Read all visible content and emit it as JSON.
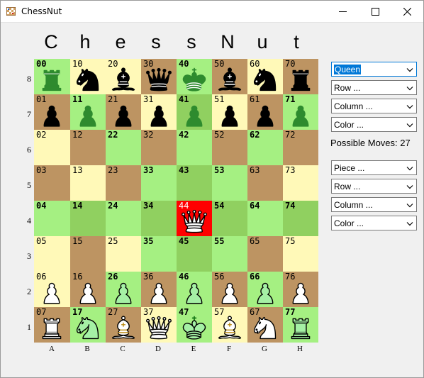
{
  "window": {
    "title": "ChessNut",
    "minimize_icon": "minimize-icon",
    "maximize_icon": "maximize-icon",
    "close_icon": "close-icon"
  },
  "header_letters": [
    "C",
    "h",
    "e",
    "s",
    "s",
    "N",
    "u",
    "t"
  ],
  "colors": {
    "light_square": "#fff9b8",
    "dark_square": "#bd9462",
    "move_light": "#a5f082",
    "move_dark": "#90d060",
    "selected": "#ff0000",
    "white_piece": "#ffffff",
    "black_piece": "#000000",
    "highlight_white_piece": "#a5f0a5",
    "highlight_black_piece": "#2e8b2e"
  },
  "board": {
    "rank_labels": [
      "8",
      "7",
      "6",
      "5",
      "4",
      "3",
      "2",
      "1"
    ],
    "file_labels": [
      "A",
      "B",
      "C",
      "D",
      "E",
      "F",
      "G",
      "H"
    ],
    "rows": [
      [
        {
          "id": "00",
          "bg": "move_light",
          "piece": "rook",
          "color": "green_dark",
          "bold": true
        },
        {
          "id": "10",
          "bg": "light",
          "piece": "knight",
          "color": "black",
          "bold": false
        },
        {
          "id": "20",
          "bg": "light",
          "piece": "bishop",
          "color": "black",
          "bold": false
        },
        {
          "id": "30",
          "bg": "dark",
          "piece": "queen",
          "color": "black",
          "bold": false
        },
        {
          "id": "40",
          "bg": "move_light",
          "piece": "king",
          "color": "green_dark",
          "bold": true
        },
        {
          "id": "50",
          "bg": "dark",
          "piece": "bishop",
          "color": "black",
          "bold": false
        },
        {
          "id": "60",
          "bg": "light",
          "piece": "knight",
          "color": "black",
          "bold": false
        },
        {
          "id": "70",
          "bg": "dark",
          "piece": "rook",
          "color": "black",
          "bold": false
        }
      ],
      [
        {
          "id": "01",
          "bg": "dark",
          "piece": "pawn",
          "color": "black",
          "bold": false
        },
        {
          "id": "11",
          "bg": "move_light",
          "piece": "pawn",
          "color": "green_dark",
          "bold": true
        },
        {
          "id": "21",
          "bg": "dark",
          "piece": "pawn",
          "color": "black",
          "bold": false
        },
        {
          "id": "31",
          "bg": "light",
          "piece": "pawn",
          "color": "black",
          "bold": false
        },
        {
          "id": "41",
          "bg": "move_dark",
          "piece": "pawn",
          "color": "green_dark",
          "bold": true
        },
        {
          "id": "51",
          "bg": "light",
          "piece": "pawn",
          "color": "black",
          "bold": false
        },
        {
          "id": "61",
          "bg": "dark",
          "piece": "pawn",
          "color": "black",
          "bold": false
        },
        {
          "id": "71",
          "bg": "move_light",
          "piece": "pawn",
          "color": "green_dark",
          "bold": true
        }
      ],
      [
        {
          "id": "02",
          "bg": "light",
          "piece": "",
          "color": "",
          "bold": false
        },
        {
          "id": "12",
          "bg": "dark",
          "piece": "",
          "color": "",
          "bold": false
        },
        {
          "id": "22",
          "bg": "move_light",
          "piece": "",
          "color": "",
          "bold": true
        },
        {
          "id": "32",
          "bg": "dark",
          "piece": "",
          "color": "",
          "bold": false
        },
        {
          "id": "42",
          "bg": "move_light",
          "piece": "",
          "color": "",
          "bold": true
        },
        {
          "id": "52",
          "bg": "dark",
          "piece": "",
          "color": "",
          "bold": false
        },
        {
          "id": "62",
          "bg": "move_light",
          "piece": "",
          "color": "",
          "bold": true
        },
        {
          "id": "72",
          "bg": "dark",
          "piece": "",
          "color": "",
          "bold": false
        }
      ],
      [
        {
          "id": "03",
          "bg": "dark",
          "piece": "",
          "color": "",
          "bold": false
        },
        {
          "id": "13",
          "bg": "light",
          "piece": "",
          "color": "",
          "bold": false
        },
        {
          "id": "23",
          "bg": "dark",
          "piece": "",
          "color": "",
          "bold": false
        },
        {
          "id": "33",
          "bg": "move_light",
          "piece": "",
          "color": "",
          "bold": true
        },
        {
          "id": "43",
          "bg": "move_dark",
          "piece": "",
          "color": "",
          "bold": true
        },
        {
          "id": "53",
          "bg": "move_light",
          "piece": "",
          "color": "",
          "bold": true
        },
        {
          "id": "63",
          "bg": "dark",
          "piece": "",
          "color": "",
          "bold": false
        },
        {
          "id": "73",
          "bg": "light",
          "piece": "",
          "color": "",
          "bold": false
        }
      ],
      [
        {
          "id": "04",
          "bg": "move_light",
          "piece": "",
          "color": "",
          "bold": true
        },
        {
          "id": "14",
          "bg": "move_dark",
          "piece": "",
          "color": "",
          "bold": true
        },
        {
          "id": "24",
          "bg": "move_light",
          "piece": "",
          "color": "",
          "bold": true
        },
        {
          "id": "34",
          "bg": "move_dark",
          "piece": "",
          "color": "",
          "bold": true
        },
        {
          "id": "44",
          "bg": "selected",
          "piece": "queen",
          "color": "white",
          "bold": false
        },
        {
          "id": "54",
          "bg": "move_dark",
          "piece": "",
          "color": "",
          "bold": true
        },
        {
          "id": "64",
          "bg": "move_light",
          "piece": "",
          "color": "",
          "bold": true
        },
        {
          "id": "74",
          "bg": "move_dark",
          "piece": "",
          "color": "",
          "bold": true
        }
      ],
      [
        {
          "id": "05",
          "bg": "light",
          "piece": "",
          "color": "",
          "bold": false
        },
        {
          "id": "15",
          "bg": "dark",
          "piece": "",
          "color": "",
          "bold": false
        },
        {
          "id": "25",
          "bg": "light",
          "piece": "",
          "color": "",
          "bold": false
        },
        {
          "id": "35",
          "bg": "move_light",
          "piece": "",
          "color": "",
          "bold": true
        },
        {
          "id": "45",
          "bg": "move_dark",
          "piece": "",
          "color": "",
          "bold": true
        },
        {
          "id": "55",
          "bg": "move_light",
          "piece": "",
          "color": "",
          "bold": true
        },
        {
          "id": "65",
          "bg": "dark",
          "piece": "",
          "color": "",
          "bold": false
        },
        {
          "id": "75",
          "bg": "light",
          "piece": "",
          "color": "",
          "bold": false
        }
      ],
      [
        {
          "id": "06",
          "bg": "light",
          "piece": "pawn",
          "color": "white",
          "bold": false
        },
        {
          "id": "16",
          "bg": "dark",
          "piece": "pawn",
          "color": "white",
          "bold": false
        },
        {
          "id": "26",
          "bg": "move_light",
          "piece": "pawn",
          "color": "green_light",
          "bold": true
        },
        {
          "id": "36",
          "bg": "dark",
          "piece": "pawn",
          "color": "white",
          "bold": false
        },
        {
          "id": "46",
          "bg": "move_light",
          "piece": "pawn",
          "color": "green_light",
          "bold": true
        },
        {
          "id": "56",
          "bg": "dark",
          "piece": "pawn",
          "color": "white",
          "bold": false
        },
        {
          "id": "66",
          "bg": "move_light",
          "piece": "pawn",
          "color": "green_light",
          "bold": true
        },
        {
          "id": "76",
          "bg": "dark",
          "piece": "pawn",
          "color": "white",
          "bold": false
        }
      ],
      [
        {
          "id": "07",
          "bg": "dark",
          "piece": "rook",
          "color": "white",
          "bold": false
        },
        {
          "id": "17",
          "bg": "move_light",
          "piece": "knight",
          "color": "green_light",
          "bold": true
        },
        {
          "id": "27",
          "bg": "dark",
          "piece": "bishop",
          "color": "white",
          "bold": false
        },
        {
          "id": "37",
          "bg": "light",
          "piece": "queen",
          "color": "white",
          "bold": false
        },
        {
          "id": "47",
          "bg": "move_light",
          "piece": "king",
          "color": "green_light",
          "bold": true
        },
        {
          "id": "57",
          "bg": "light",
          "piece": "bishop",
          "color": "white",
          "bold": false
        },
        {
          "id": "67",
          "bg": "dark",
          "piece": "knight",
          "color": "white",
          "bold": false
        },
        {
          "id": "77",
          "bg": "move_light",
          "piece": "rook",
          "color": "green_light",
          "bold": true
        }
      ]
    ]
  },
  "side_panel": {
    "top_combos": [
      {
        "name": "piece-select-top",
        "value": "Queen",
        "selected": true
      },
      {
        "name": "row-select-top",
        "value": "Row ...",
        "selected": false
      },
      {
        "name": "column-select-top",
        "value": "Column ...",
        "selected": false
      },
      {
        "name": "color-select-top",
        "value": "Color ...",
        "selected": false
      }
    ],
    "possible_moves_label": "Possible Moves:",
    "possible_moves_count": "27",
    "bottom_combos": [
      {
        "name": "piece-select-bottom",
        "value": "Piece ...",
        "selected": false
      },
      {
        "name": "row-select-bottom",
        "value": "Row ...",
        "selected": false
      },
      {
        "name": "column-select-bottom",
        "value": "Column ...",
        "selected": false
      },
      {
        "name": "color-select-bottom",
        "value": "Color ...",
        "selected": false
      }
    ]
  }
}
